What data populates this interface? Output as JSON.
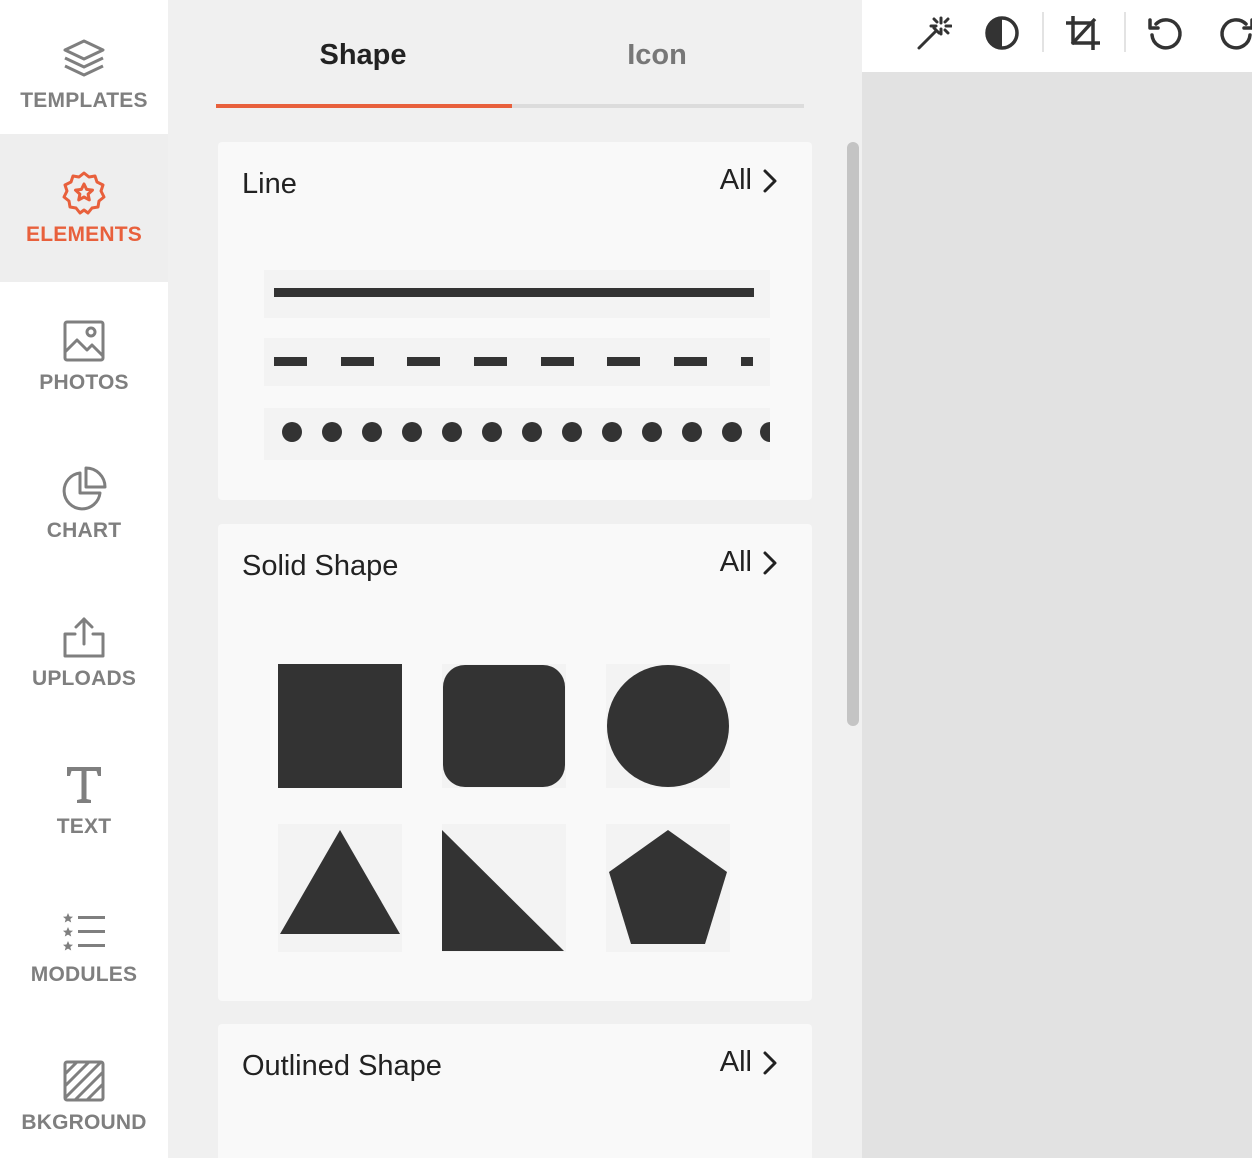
{
  "sidebar": {
    "items": [
      {
        "label": "TEMPLATES",
        "icon": "layers-icon",
        "active": false
      },
      {
        "label": "ELEMENTS",
        "icon": "badge-star-icon",
        "active": true
      },
      {
        "label": "PHOTOS",
        "icon": "image-icon",
        "active": false
      },
      {
        "label": "CHART",
        "icon": "pie-chart-icon",
        "active": false
      },
      {
        "label": "UPLOADS",
        "icon": "upload-icon",
        "active": false
      },
      {
        "label": "TEXT",
        "icon": "text-icon",
        "active": false
      },
      {
        "label": "MODULES",
        "icon": "star-list-icon",
        "active": false
      },
      {
        "label": "BKGROUND",
        "icon": "background-icon",
        "active": false
      }
    ],
    "accent_color": "#e8603c",
    "inactive_color": "#7f7f7f"
  },
  "panel": {
    "tabs": [
      {
        "label": "Shape",
        "active": true
      },
      {
        "label": "Icon",
        "active": false
      }
    ],
    "sections": [
      {
        "title": "Line",
        "all_label": "All",
        "items": [
          "solid-line",
          "dashed-line",
          "dotted-line"
        ]
      },
      {
        "title": "Solid Shape",
        "all_label": "All",
        "items": [
          "square",
          "rounded-square",
          "circle",
          "triangle",
          "right-triangle",
          "pentagon"
        ]
      },
      {
        "title": "Outlined Shape",
        "all_label": "All",
        "items": []
      }
    ],
    "shape_color": "#333333"
  },
  "toolbar": {
    "buttons": [
      "magic-wand-icon",
      "contrast-icon",
      "crop-icon",
      "undo-icon",
      "redo-icon"
    ]
  }
}
